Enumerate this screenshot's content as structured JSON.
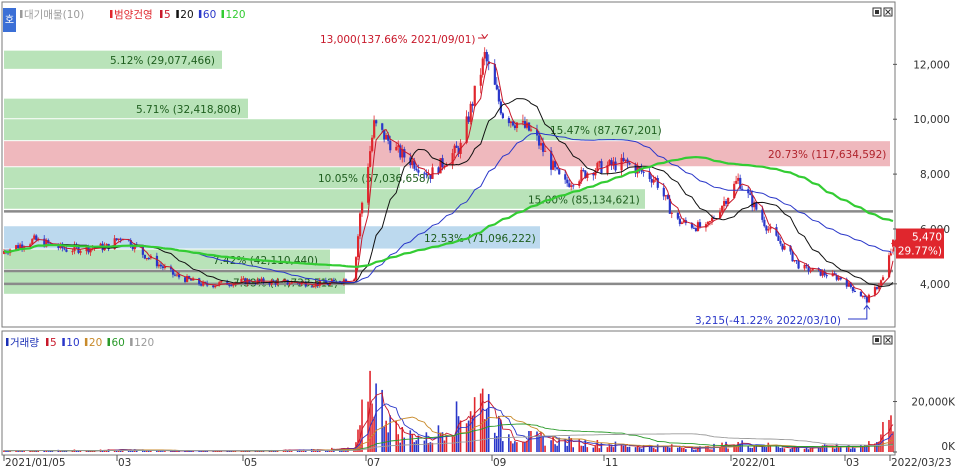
{
  "header": {
    "badge": "호",
    "legend_items": [
      {
        "label": "대기매물(10)",
        "color": "#9b9b9b"
      },
      {
        "label": "범양건영",
        "color": "#e0262d"
      },
      {
        "label": "5",
        "color": "#c8182a"
      },
      {
        "label": "20",
        "color": "#111111"
      },
      {
        "label": "60",
        "color": "#2a37c9"
      },
      {
        "label": "120",
        "color": "#33cc33"
      }
    ]
  },
  "volume_header": {
    "legend_items": [
      {
        "label": "거래량",
        "color": "#1a2fb5"
      },
      {
        "label": "5",
        "color": "#c8182a"
      },
      {
        "label": "10",
        "color": "#2a37c9"
      },
      {
        "label": "20",
        "color": "#c88a2a"
      },
      {
        "label": "60",
        "color": "#2a9a2a"
      },
      {
        "label": "120",
        "color": "#9b9b9b"
      }
    ]
  },
  "annotations": {
    "high": "13,000(137.66% 2021/09/01)",
    "low": "3,215(-41.22% 2022/03/10)",
    "last_price": "5,470",
    "last_change": "( 29.77%)"
  },
  "x_axis": {
    "labels": [
      "2021/01/05",
      "03",
      "05",
      "07",
      "09",
      "11",
      "2022/01",
      "03",
      "2022/03/23"
    ]
  },
  "chart_data": [
    {
      "type": "candlestick",
      "title": "범양건영",
      "y_axis": {
        "ticks": [
          4000,
          6000,
          8000,
          10000,
          12000
        ],
        "tick_labels": [
          "4,000",
          "6,000",
          "8,000",
          "10,000",
          "12,000"
        ],
        "range": [
          2500,
          14200
        ]
      },
      "price_bands": [
        {
          "label": "5.12% (29,077,466)",
          "percent": 5.12,
          "volume": 29077466,
          "range": [
            11800,
            12500
          ],
          "color": "#b9e3b9"
        },
        {
          "label": "5.71% (32,418,808)",
          "percent": 5.71,
          "volume": 32418808,
          "range": [
            10000,
            10750
          ],
          "color": "#b9e3b9"
        },
        {
          "label": "15.47% (87,767,201)",
          "percent": 15.47,
          "volume": 87767201,
          "range": [
            9200,
            10000
          ],
          "color": "#b9e3b9"
        },
        {
          "label": "20.73% (117,634,592)",
          "percent": 20.73,
          "volume": 117634592,
          "range": [
            8250,
            9200
          ],
          "color": "#efb8bd"
        },
        {
          "label": "10.05% (57,036,658)",
          "percent": 10.05,
          "volume": 57036658,
          "range": [
            7450,
            8250
          ],
          "color": "#b9e3b9"
        },
        {
          "label": "15.00% (85,134,621)",
          "percent": 15.0,
          "volume": 85134621,
          "range": [
            6700,
            7450
          ],
          "color": "#b9e3b9"
        },
        {
          "label": "12.53% (71,096,222)",
          "percent": 12.53,
          "volume": 71096222,
          "range": [
            5250,
            6100
          ],
          "color": "#bcd9ee"
        },
        {
          "label": "7.42% (42,110,440)",
          "percent": 7.42,
          "volume": 42110440,
          "range": [
            4500,
            5250
          ],
          "color": "#b9e3b9"
        },
        {
          "label": "7.88% (44,733,512)",
          "percent": 7.88,
          "volume": 44733512,
          "range": [
            3600,
            4500
          ],
          "color": "#b9e3b9"
        }
      ],
      "horizontal_lines": [
        6640,
        4470,
        4000
      ],
      "series": [
        {
          "name": "close",
          "points": [
            {
              "x": "2021-01-05",
              "y": 5200
            },
            {
              "x": "2021-01-20",
              "y": 5600
            },
            {
              "x": "2021-02-05",
              "y": 5250
            },
            {
              "x": "2021-02-25",
              "y": 5350
            },
            {
              "x": "2021-03-05",
              "y": 5750
            },
            {
              "x": "2021-03-15",
              "y": 5100
            },
            {
              "x": "2021-03-31",
              "y": 4300
            },
            {
              "x": "2021-04-15",
              "y": 3950
            },
            {
              "x": "2021-05-05",
              "y": 4100
            },
            {
              "x": "2021-05-25",
              "y": 4050
            },
            {
              "x": "2021-06-15",
              "y": 4000
            },
            {
              "x": "2021-06-28",
              "y": 4250
            },
            {
              "x": "2021-07-01",
              "y": 6500
            },
            {
              "x": "2021-07-08",
              "y": 9800
            },
            {
              "x": "2021-07-20",
              "y": 8800
            },
            {
              "x": "2021-08-05",
              "y": 8000
            },
            {
              "x": "2021-08-20",
              "y": 9000
            },
            {
              "x": "2021-09-01",
              "y": 12300
            },
            {
              "x": "2021-09-10",
              "y": 10200
            },
            {
              "x": "2021-09-25",
              "y": 9500
            },
            {
              "x": "2021-10-10",
              "y": 7600
            },
            {
              "x": "2021-10-25",
              "y": 8200
            },
            {
              "x": "2021-11-10",
              "y": 8400
            },
            {
              "x": "2021-11-25",
              "y": 7800
            },
            {
              "x": "2021-12-05",
              "y": 6300
            },
            {
              "x": "2021-12-20",
              "y": 6000
            },
            {
              "x": "2022-01-05",
              "y": 7800
            },
            {
              "x": "2022-01-20",
              "y": 6000
            },
            {
              "x": "2022-02-05",
              "y": 4600
            },
            {
              "x": "2022-02-25",
              "y": 4200
            },
            {
              "x": "2022-03-10",
              "y": 3400
            },
            {
              "x": "2022-03-18",
              "y": 4200
            },
            {
              "x": "2022-03-23",
              "y": 5470
            }
          ]
        },
        {
          "name": "5",
          "color": "#c8182a"
        },
        {
          "name": "20",
          "color": "#111111"
        },
        {
          "name": "60",
          "color": "#2a37c9"
        },
        {
          "name": "120",
          "color": "#33cc33"
        }
      ]
    },
    {
      "type": "bar",
      "title": "거래량",
      "y_axis": {
        "ticks": [
          0,
          20000000
        ],
        "tick_labels": [
          "0K",
          "20,000K"
        ],
        "range": [
          0,
          42000000
        ]
      },
      "points": [
        {
          "x": "2021-01-05",
          "y": 600000
        },
        {
          "x": "2021-03-05",
          "y": 900000
        },
        {
          "x": "2021-05-05",
          "y": 400000
        },
        {
          "x": "2021-06-28",
          "y": 1500000
        },
        {
          "x": "2021-07-01",
          "y": 10000000
        },
        {
          "x": "2021-07-05",
          "y": 35000000
        },
        {
          "x": "2021-07-08",
          "y": 28000000
        },
        {
          "x": "2021-07-20",
          "y": 9000000
        },
        {
          "x": "2021-08-05",
          "y": 6000000
        },
        {
          "x": "2021-09-01",
          "y": 26000000
        },
        {
          "x": "2021-09-10",
          "y": 8000000
        },
        {
          "x": "2021-10-10",
          "y": 5000000
        },
        {
          "x": "2021-11-10",
          "y": 3000000
        },
        {
          "x": "2021-12-20",
          "y": 2000000
        },
        {
          "x": "2022-01-05",
          "y": 4000000
        },
        {
          "x": "2022-02-05",
          "y": 2000000
        },
        {
          "x": "2022-03-10",
          "y": 3000000
        },
        {
          "x": "2022-03-23",
          "y": 14000000
        }
      ]
    }
  ]
}
